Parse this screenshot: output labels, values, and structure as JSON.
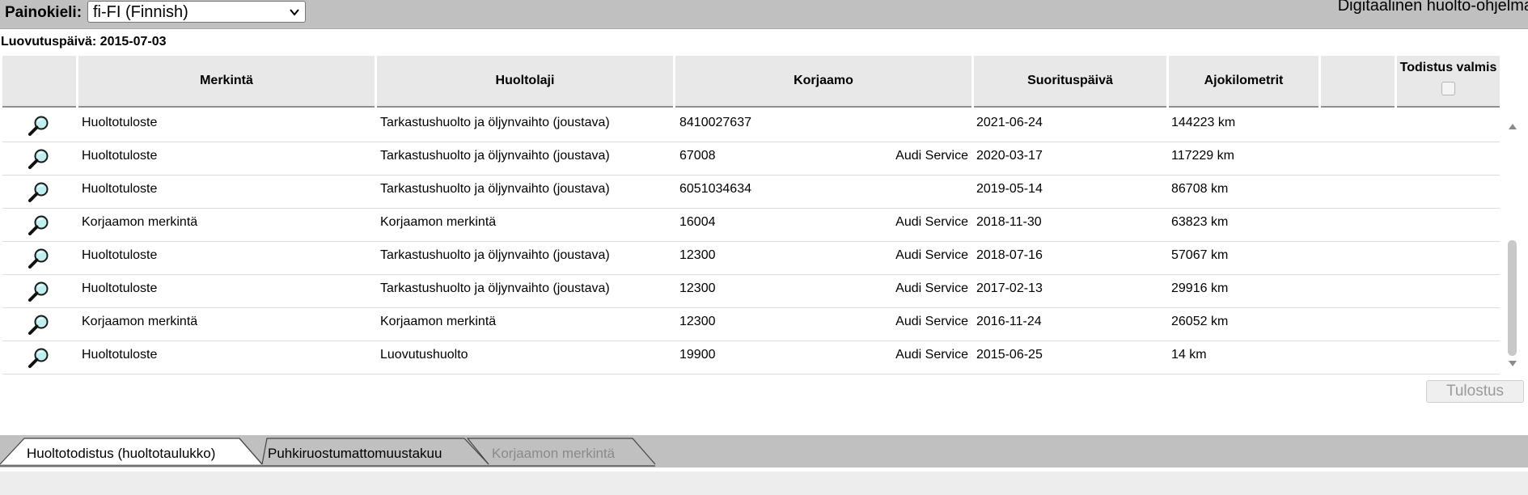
{
  "toolbar": {
    "language_label": "Painokieli:",
    "language_value": "fi-FI (Finnish)",
    "app_title": "Digitaalinen huolto-ohjelma"
  },
  "delivery_date": "Luovutuspäivä: 2015-07-03",
  "table": {
    "headers": [
      "Merkintä",
      "Huoltolaji",
      "Korjaamo",
      "Suorituspäivä",
      "Ajokilometrit",
      "",
      "Todistus valmis"
    ],
    "rows": [
      {
        "merkinta": "Huoltotuloste",
        "huoltolaji": "Tarkastushuolto ja öljynvaihto (joustava)",
        "korjaamo_nro": "8410027637",
        "korjaamo_nimi": "",
        "pvm": "2021-06-24",
        "km": "144223 km"
      },
      {
        "merkinta": "Huoltotuloste",
        "huoltolaji": "Tarkastushuolto ja öljynvaihto (joustava)",
        "korjaamo_nro": "67008",
        "korjaamo_nimi": "Audi Service",
        "pvm": "2020-03-17",
        "km": "117229 km"
      },
      {
        "merkinta": "Huoltotuloste",
        "huoltolaji": "Tarkastushuolto ja öljynvaihto (joustava)",
        "korjaamo_nro": "6051034634",
        "korjaamo_nimi": "",
        "pvm": "2019-05-14",
        "km": "86708 km"
      },
      {
        "merkinta": "Korjaamon merkintä",
        "huoltolaji": "Korjaamon merkintä",
        "korjaamo_nro": "16004",
        "korjaamo_nimi": "Audi Service",
        "pvm": "2018-11-30",
        "km": "63823 km"
      },
      {
        "merkinta": "Huoltotuloste",
        "huoltolaji": "Tarkastushuolto ja öljynvaihto (joustava)",
        "korjaamo_nro": "12300",
        "korjaamo_nimi": "Audi Service",
        "pvm": "2018-07-16",
        "km": "57067 km"
      },
      {
        "merkinta": "Huoltotuloste",
        "huoltolaji": "Tarkastushuolto ja öljynvaihto (joustava)",
        "korjaamo_nro": "12300",
        "korjaamo_nimi": "Audi Service",
        "pvm": "2017-02-13",
        "km": "29916 km"
      },
      {
        "merkinta": "Korjaamon merkintä",
        "huoltolaji": "Korjaamon merkintä",
        "korjaamo_nro": "12300",
        "korjaamo_nimi": "Audi Service",
        "pvm": "2016-11-24",
        "km": "26052 km"
      },
      {
        "merkinta": "Huoltotuloste",
        "huoltolaji": "Luovutushuolto",
        "korjaamo_nro": "19900",
        "korjaamo_nimi": "Audi Service",
        "pvm": "2015-06-25",
        "km": "14 km"
      }
    ]
  },
  "print_button": "Tulostus",
  "tabs": [
    {
      "label": "Huoltotodistus (huoltotaulukko)",
      "active": true,
      "disabled": false
    },
    {
      "label": "Puhkiruostumattomuustakuu",
      "active": false,
      "disabled": false
    },
    {
      "label": "Korjaamon merkintä",
      "active": false,
      "disabled": true
    }
  ],
  "icons": {
    "row_action": "magnifier-icon",
    "select_chevron": "chevron-down-icon",
    "scroll_up": "scroll-up-arrow-icon",
    "scroll_down": "scroll-down-arrow-icon"
  },
  "colors": {
    "toolbar_bg": "#c0c0c0",
    "header_bg": "#e8e8e8",
    "tab_disabled_text": "#8a8a8a"
  }
}
